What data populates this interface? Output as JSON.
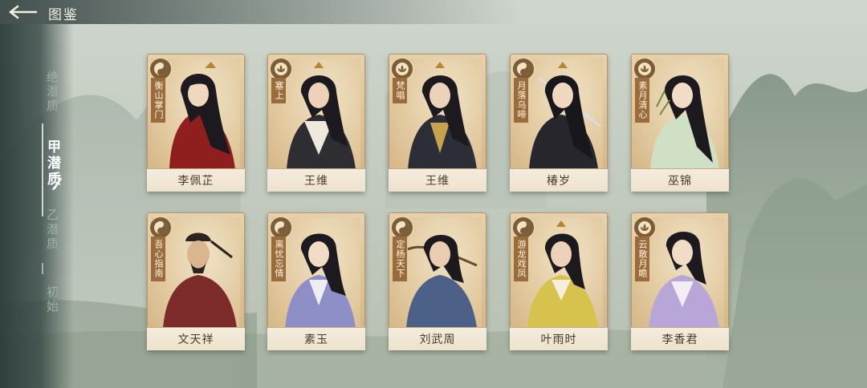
{
  "header": {
    "title": "图鉴",
    "back_icon": "arrow-left-icon"
  },
  "sidebar": {
    "tabs": [
      {
        "label": "绝潜质",
        "active": false
      },
      {
        "label": "甲潜质",
        "active": true
      },
      {
        "label": "乙潜质",
        "active": false
      },
      {
        "label": "初始",
        "active": false
      }
    ]
  },
  "cards": [
    {
      "name": "李佩芷",
      "title": "衡山掌门",
      "emblem": "yin-yang-emblem-icon",
      "robe": "#8f1f1f",
      "hair": "#1c1a1e"
    },
    {
      "name": "王维",
      "title": "塞上",
      "emblem": "lotus-emblem-icon",
      "robe": "#2d2d32",
      "hair": "#1c1a1e"
    },
    {
      "name": "王维",
      "title": "梵唱",
      "emblem": "lotus-emblem-icon",
      "robe": "#2b2e36",
      "hair": "#1c1a1e"
    },
    {
      "name": "椿岁",
      "title": "月落乌啼",
      "emblem": "yin-yang-emblem-icon",
      "robe": "#26262c",
      "hair": "#18171b"
    },
    {
      "name": "巫锦",
      "title": "素月清心",
      "emblem": "lotus-emblem-icon",
      "robe": "#cfe0c4",
      "hair": "#1c1a1e"
    },
    {
      "name": "文天祥",
      "title": "吾心指南",
      "emblem": "yin-yang-emblem-icon",
      "robe": "#7c2a2a",
      "hair": "#2a2320"
    },
    {
      "name": "素玉",
      "title": "离忧忘情",
      "emblem": "yin-yang-emblem-icon",
      "robe": "#8d8fc6",
      "hair": "#1c1a1e"
    },
    {
      "name": "刘武周",
      "title": "定杨天下",
      "emblem": "yin-yang-emblem-icon",
      "robe": "#4c6088",
      "hair": "#1c1a1e"
    },
    {
      "name": "叶雨时",
      "title": "游龙戏凤",
      "emblem": "yin-yang-emblem-icon",
      "robe": "#d7c24e",
      "hair": "#1c1a1e"
    },
    {
      "name": "李香君",
      "title": "云散月瞻",
      "emblem": "lotus-emblem-icon",
      "robe": "#b9a6d8",
      "hair": "#1c1a1e"
    }
  ]
}
